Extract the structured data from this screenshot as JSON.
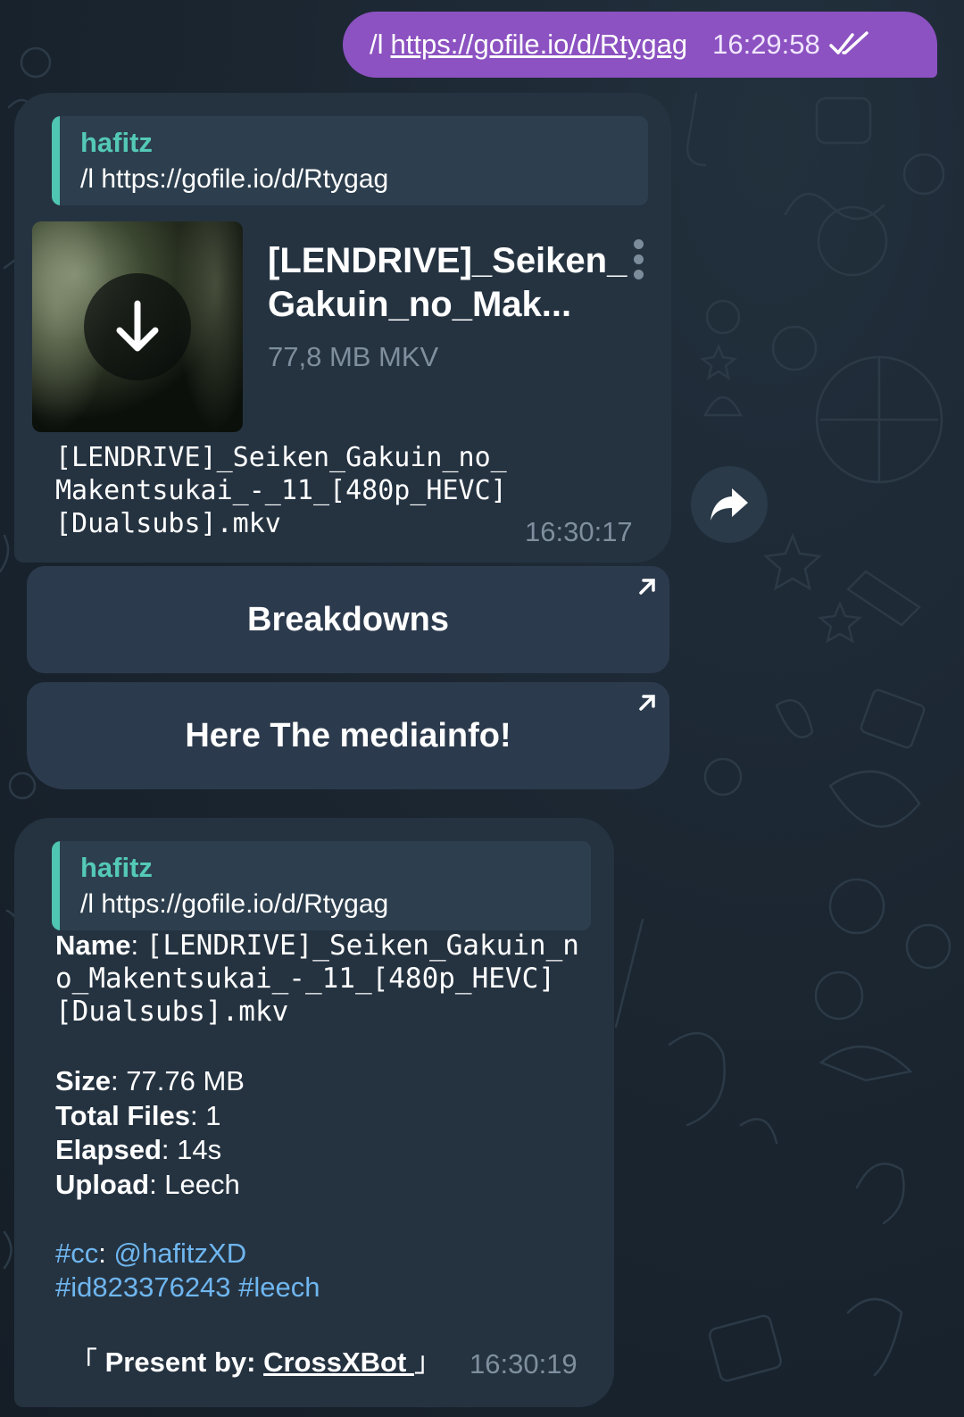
{
  "outgoing": {
    "command": "/l",
    "link": "https://gofile.io/d/Rtygag",
    "time": "16:29:58",
    "status_icon": "double-check-icon"
  },
  "message1": {
    "reply": {
      "sender": "hafitz",
      "text": "/l https://gofile.io/d/Rtygag"
    },
    "file": {
      "title_line1": "[LENDRIVE]_Seiken_",
      "title_line2": "Gakuin_no_Mak...",
      "meta": "77,8 MB MKV"
    },
    "caption": [
      "[LENDRIVE]_Seiken_Gakuin_no_",
      "Makentsukai_-_11_[480p_HEVC]",
      "[Dualsubs].mkv"
    ],
    "time": "16:30:17"
  },
  "buttons": {
    "breakdowns": "Breakdowns",
    "mediainfo": "Here The mediainfo!"
  },
  "message2": {
    "reply": {
      "sender": "hafitz",
      "text": "/l https://gofile.io/d/Rtygag"
    },
    "name_label": "Name",
    "name_value": [
      "[LENDRIVE]_Seiken_Gakuin_n",
      "o_Makentsukai_-_11_[480p_HEVC]",
      "[Dualsubs].mkv"
    ],
    "size_label": "Size",
    "size_value": "77.76 MB",
    "total_label": "Total Files",
    "total_value": "1",
    "elapsed_label": "Elapsed",
    "elapsed_value": "14s",
    "upload_label": "Upload",
    "upload_value": "Leech",
    "cc_tag": "#cc",
    "cc_user": "@hafitzXD",
    "tag_id": "#id823376243",
    "tag_leech": "#leech",
    "credit_open": "「 ",
    "credit_label": "Present by:",
    "credit_bot": "CrossXBot ",
    "credit_close": "」",
    "time": "16:30:19"
  },
  "colors": {
    "outgoing_bubble": "#8c52c1",
    "incoming_bubble": "#253341",
    "reply_accent": "#4fc6b1",
    "hashtag": "#6fb6ef"
  }
}
